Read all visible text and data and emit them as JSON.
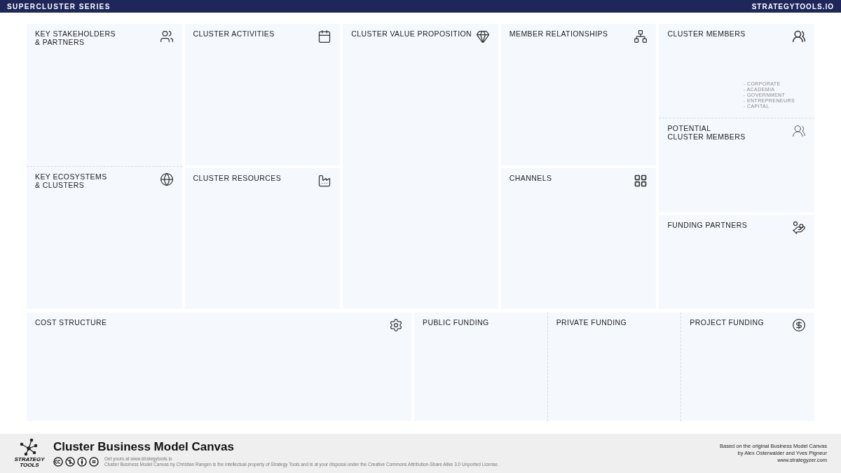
{
  "header": {
    "series": "SUPERCLUSTER SERIES",
    "site": "STRATEGYTOOLS.IO"
  },
  "columns": [
    {
      "sections": [
        {
          "title": "KEY STAKEHOLDERS\n& PARTNERS",
          "joined": false
        },
        {
          "title": "KEY ECOSYSTEMS\n& CLUSTERS",
          "joined": true
        }
      ]
    },
    {
      "sections": [
        {
          "title": "CLUSTER ACTIVITIES",
          "joined": false
        },
        {
          "title": "CLUSTER RESOURCES",
          "joined": false
        }
      ]
    },
    {
      "sections": [
        {
          "title": "CLUSTER VALUE PROPOSITION",
          "joined": false
        }
      ]
    },
    {
      "sections": [
        {
          "title": "MEMBER RELATIONSHIPS",
          "joined": false
        },
        {
          "title": "CHANNELS",
          "joined": false
        }
      ]
    },
    {
      "sections": [
        {
          "title": "CLUSTER MEMBERS",
          "joined": false,
          "notes": [
            "- CORPORATE",
            "- ACADEMIA",
            "- GOVERNMENT",
            "- ENTREPRENEURS",
            "- CAPITAL"
          ]
        },
        {
          "title": "POTENTIAL\nCLUSTER MEMBERS",
          "joined": true
        },
        {
          "title": "FUNDING PARTNERS",
          "joined": false
        }
      ]
    }
  ],
  "bottom": [
    {
      "sections": [
        {
          "title": "COST STRUCTURE",
          "joined": false
        }
      ]
    },
    {
      "sections": [
        {
          "title": "PUBLIC FUNDING",
          "joined": false
        },
        {
          "title": "PRIVATE FUNDING",
          "joined": true
        },
        {
          "title": "PROJECT FUNDING",
          "joined": true
        }
      ]
    }
  ],
  "footer": {
    "logo": "STRATEGY\nTOOLS",
    "title": "Cluster Business Model Canvas",
    "get_yours": "Get yours at www.strategytools.io",
    "license": "Cluster Business Model Canvas by Christian Rangen is the intellectual property of Strategy Tools and is at your disposal under the Creative Commons Attribution-Share Alike 3.0 Unported License.",
    "credits": [
      "Based on the original Business Model Canvas",
      "by Alex Osterwalder and Yves Pigneur",
      "www.strategyzer.com"
    ]
  }
}
